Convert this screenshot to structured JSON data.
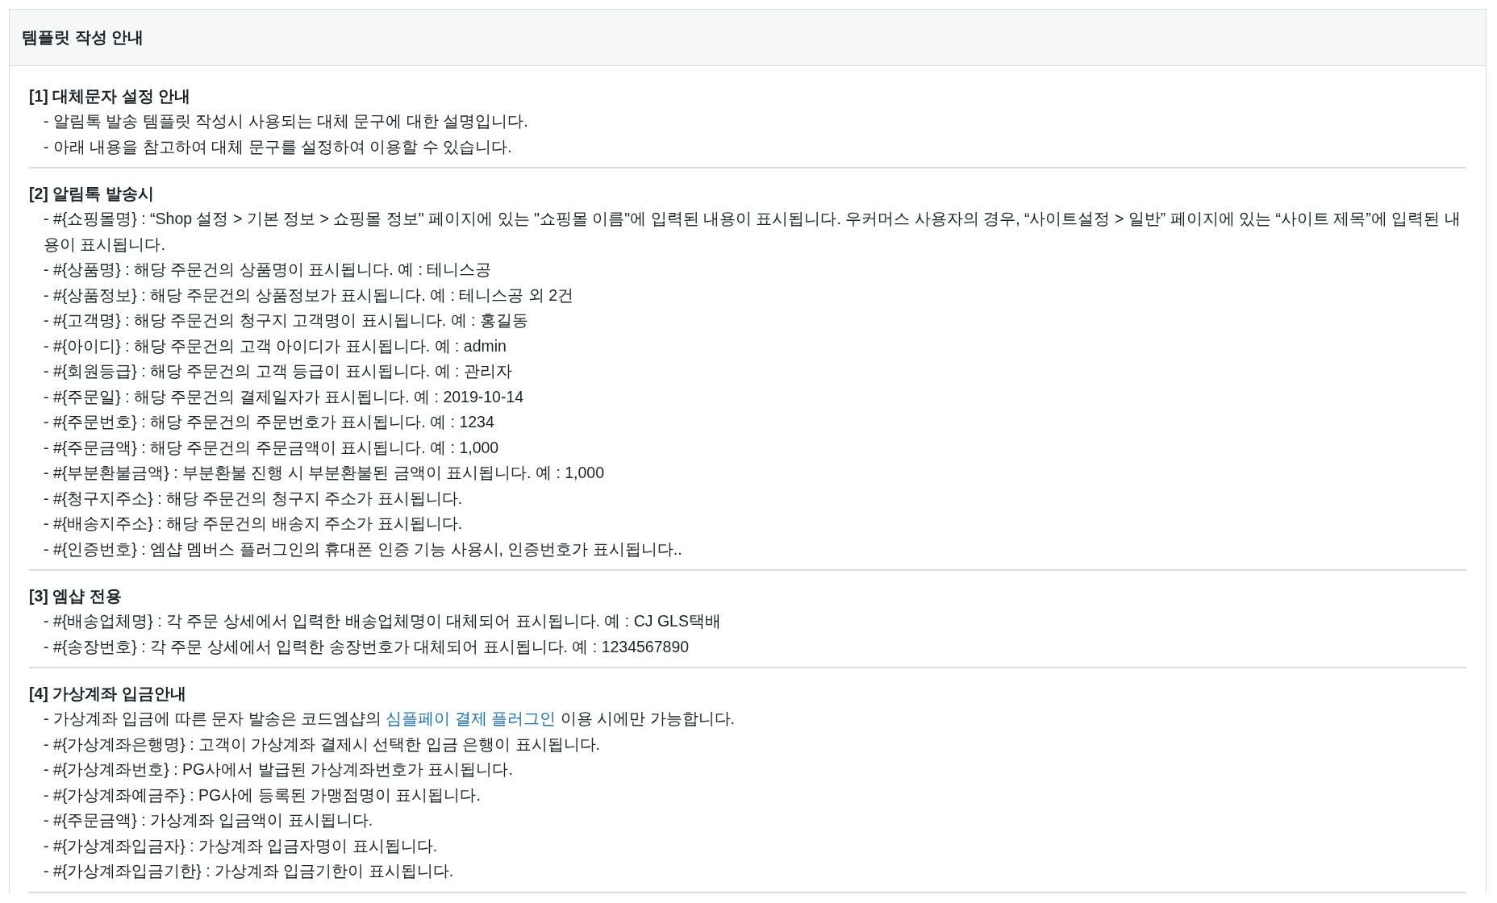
{
  "panel": {
    "title": "템플릿 작성 안내"
  },
  "sections": [
    {
      "heading": "[1] 대체문자 설정 안내",
      "items": [
        {
          "kind": "text",
          "text": "- 알림톡 발송 템플릿 작성시 사용되는 대체 문구에 대한 설명입니다."
        },
        {
          "kind": "text",
          "text": "- 아래 내용을 참고하여 대체 문구를 설정하여 이용할 수 있습니다."
        }
      ]
    },
    {
      "heading": "[2] 알림톡 발송시",
      "items": [
        {
          "kind": "text",
          "text": "- #{쇼핑몰명} : “Shop 설정 > 기본 정보 > 쇼핑몰 정보\" 페이지에 있는 \"쇼핑몰 이름\"에 입력된 내용이 표시됩니다. 우커머스 사용자의 경우, “사이트설정 > 일반” 페이지에 있는 “사이트 제목”에 입력된 내용이 표시됩니다."
        },
        {
          "kind": "text",
          "text": "- #{상품명} : 해당 주문건의 상품명이 표시됩니다. 예 : 테니스공"
        },
        {
          "kind": "text",
          "text": "- #{상품정보} : 해당 주문건의 상품정보가 표시됩니다. 예 : 테니스공 외 2건"
        },
        {
          "kind": "text",
          "text": "- #{고객명} : 해당 주문건의 청구지 고객명이 표시됩니다. 예 : 홍길동"
        },
        {
          "kind": "text",
          "text": "- #{아이디} : 해당 주문건의 고객 아이디가 표시됩니다. 예 : admin"
        },
        {
          "kind": "text",
          "text": "- #{회원등급} : 해당 주문건의 고객 등급이 표시됩니다. 예 : 관리자"
        },
        {
          "kind": "text",
          "text": "- #{주문일} : 해당 주문건의 결제일자가 표시됩니다. 예 : 2019-10-14"
        },
        {
          "kind": "text",
          "text": "- #{주문번호} : 해당 주문건의 주문번호가 표시됩니다. 예 : 1234"
        },
        {
          "kind": "text",
          "text": "- #{주문금액} : 해당 주문건의 주문금액이 표시됩니다. 예 : 1,000"
        },
        {
          "kind": "text",
          "text": "- #{부분환불금액} : 부분환불 진행 시 부분환불된 금액이 표시됩니다. 예 : 1,000"
        },
        {
          "kind": "text",
          "text": "- #{청구지주소} : 해당 주문건의 청구지 주소가 표시됩니다."
        },
        {
          "kind": "text",
          "text": "- #{배송지주소} : 해당 주문건의 배송지 주소가 표시됩니다."
        },
        {
          "kind": "text",
          "text": "- #{인증번호} : 엠샵 멤버스 플러그인의 휴대폰 인증 기능 사용시, 인증번호가 표시됩니다.."
        }
      ]
    },
    {
      "heading": "[3] 엠샵 전용",
      "items": [
        {
          "kind": "text",
          "text": "- #{배송업체명} : 각 주문 상세에서 입력한 배송업체명이 대체되어 표시됩니다. 예 : CJ GLS택배"
        },
        {
          "kind": "text",
          "text": "- #{송장번호} : 각 주문 상세에서 입력한 송장번호가 대체되어 표시됩니다. 예 : 1234567890"
        }
      ]
    },
    {
      "heading": "[4] 가상계좌 입금안내",
      "items": [
        {
          "kind": "link",
          "before": "- 가상계좌 입금에 따른 문자 발송은 코드엠샵의",
          "link": "심플페이 결제 플러그인",
          "after": "이용 시에만 가능합니다."
        },
        {
          "kind": "text",
          "text": "- #{가상계좌은행명} : 고객이 가상계좌 결제시 선택한 입금 은행이 표시됩니다."
        },
        {
          "kind": "text",
          "text": "- #{가상계좌번호} : PG사에서 발급된 가상계좌번호가 표시됩니다."
        },
        {
          "kind": "text",
          "text": "- #{가상계좌예금주} : PG사에 등록된 가맹점명이 표시됩니다."
        },
        {
          "kind": "text",
          "text": "- #{주문금액} : 가상계좌 입금액이 표시됩니다."
        },
        {
          "kind": "text",
          "text": "- #{가상계좌입금자} : 가상계좌 입금자명이 표시됩니다."
        },
        {
          "kind": "text",
          "text": "- #{가상계좌입금기한} : 가상계좌 입금기한이 표시됩니다."
        }
      ]
    }
  ]
}
